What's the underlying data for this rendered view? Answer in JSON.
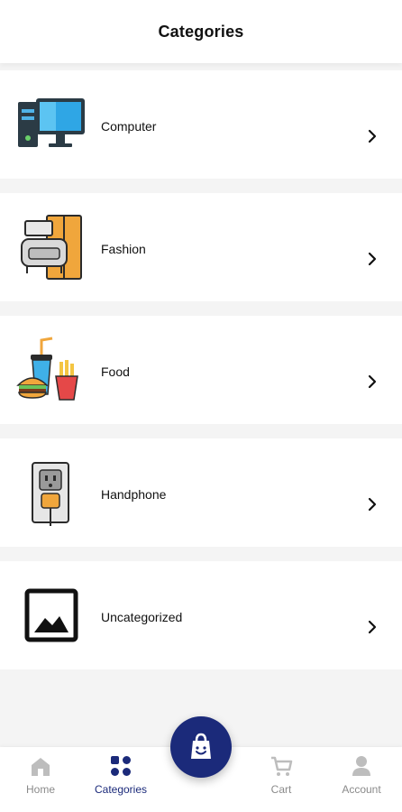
{
  "header": {
    "title": "Categories"
  },
  "categories": [
    {
      "label": "Computer",
      "icon": "computer-icon"
    },
    {
      "label": "Fashion",
      "icon": "wardrobe-sofa-icon"
    },
    {
      "label": "Food",
      "icon": "fast-food-icon"
    },
    {
      "label": "Handphone",
      "icon": "power-outlet-icon"
    },
    {
      "label": "Uncategorized",
      "icon": "image-placeholder-icon"
    }
  ],
  "bottom_nav": {
    "items": [
      {
        "label": "Home",
        "icon": "home-icon",
        "active": false
      },
      {
        "label": "Categories",
        "icon": "grid-icon",
        "active": true
      },
      {
        "label": "Cart",
        "icon": "cart-icon",
        "active": false
      },
      {
        "label": "Account",
        "icon": "user-icon",
        "active": false
      }
    ],
    "fab_icon": "shopping-bag-smile-icon"
  },
  "colors": {
    "accent": "#1b2a7a",
    "muted": "#8a8a8a",
    "background": "#f4f4f4"
  }
}
